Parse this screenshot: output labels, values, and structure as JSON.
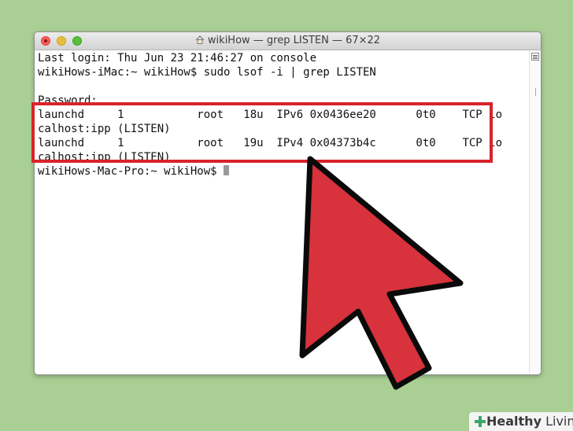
{
  "window": {
    "title": "wikiHow — grep LISTEN — 67×22"
  },
  "terminal": {
    "lines": [
      "Last login: Thu Jun 23 21:46:27 on console",
      "wikiHows-iMac:~ wikiHow$ sudo lsof -i | grep LISTEN",
      "",
      "Password:",
      "launchd     1           root   18u  IPv6 0x0436ee20      0t0    TCP lo",
      "calhost:ipp (LISTEN)",
      "launchd     1           root   19u  IPv4 0x04373b4c      0t0    TCP lo",
      "calhost:ipp (LISTEN)",
      "wikiHows-Mac-Pro:~ wikiHow$ "
    ]
  },
  "annotation": {
    "highlight_color": "#d8232a",
    "arrow_color": "#d8323c"
  },
  "watermark": {
    "brand_bold": "Healthy",
    "brand_rest": " Living",
    "icon": "plus-icon"
  }
}
